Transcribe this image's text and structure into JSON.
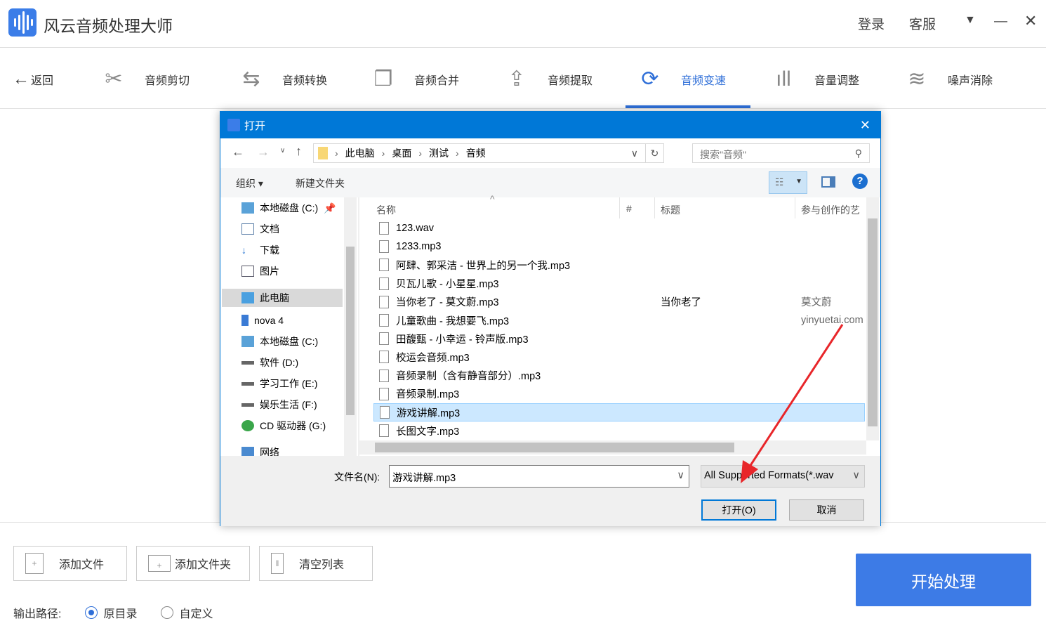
{
  "app": {
    "title": "风云音频处理大师",
    "login": "登录",
    "service": "客服"
  },
  "nav": {
    "back": "返回",
    "tools": [
      "音频剪切",
      "音频转换",
      "音频合并",
      "音频提取",
      "音频变速",
      "音量调整",
      "噪声消除"
    ],
    "active": "音频变速"
  },
  "actions": {
    "add_file": "添加文件",
    "add_folder": "添加文件夹",
    "clear_list": "清空列表",
    "start": "开始处理"
  },
  "output": {
    "label": "输出路径:",
    "options": [
      "原目录",
      "自定义"
    ],
    "selected": "原目录"
  },
  "dialog": {
    "title": "打开",
    "breadcrumb": [
      "此电脑",
      "桌面",
      "测试",
      "音频"
    ],
    "search_placeholder": "搜索\"音频\"",
    "organize": "组织 ▾",
    "new_folder": "新建文件夹",
    "nav_items": [
      "本地磁盘 (C:)",
      "文档",
      "下载",
      "图片",
      "此电脑",
      "nova 4",
      "本地磁盘 (C:)",
      "软件 (D:)",
      "学习工作 (E:)",
      "娱乐生活 (F:)",
      "CD 驱动器 (G:)",
      "网络"
    ],
    "columns": [
      "名称",
      "#",
      "标题",
      "参与创作的艺"
    ],
    "files": [
      {
        "name": "123.wav"
      },
      {
        "name": "1233.mp3"
      },
      {
        "name": "阿肆、郭采洁 - 世界上的另一个我.mp3"
      },
      {
        "name": "贝瓦儿歌 - 小星星.mp3"
      },
      {
        "name": "当你老了 - 莫文蔚.mp3",
        "title": "当你老了",
        "artist": "莫文蔚"
      },
      {
        "name": "儿童歌曲 - 我想要飞.mp3",
        "artist": "yinyuetai.com"
      },
      {
        "name": "田馥甄 - 小幸运 - 铃声版.mp3"
      },
      {
        "name": "校运会音频.mp3"
      },
      {
        "name": "音频录制（含有静音部分）.mp3"
      },
      {
        "name": "音频录制.mp3"
      },
      {
        "name": "游戏讲解.mp3"
      },
      {
        "name": "长图文字.mp3"
      }
    ],
    "selected_file": "游戏讲解.mp3",
    "filename_label": "文件名(N):",
    "filename_value": "游戏讲解.mp3",
    "filter": "All Supported Formats(*.wav",
    "open": "打开(O)",
    "cancel": "取消"
  },
  "colors": {
    "accent": "#2f6fd8",
    "dialog_title": "#0078d7",
    "arrow": "#e8262a"
  }
}
